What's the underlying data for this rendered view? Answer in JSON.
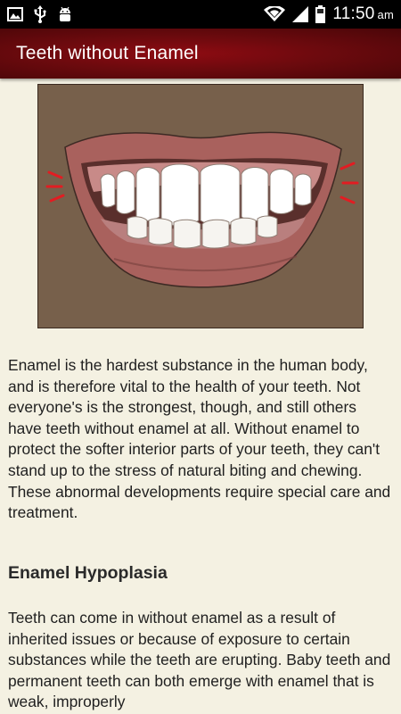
{
  "status_bar": {
    "left_icons": [
      "image-icon",
      "usb-icon",
      "android-icon"
    ],
    "right_icons": [
      "wifi-icon",
      "signal-icon",
      "battery-icon"
    ],
    "time": "11:50",
    "ampm": "am"
  },
  "app_bar": {
    "title": "Teeth without Enamel"
  },
  "article": {
    "illustration_icon": "teeth-smile-illustration",
    "paragraph1": "Enamel is the hardest substance in the human body, and is therefore vital to the health of your teeth. Not everyone's is the strongest, though, and still others have teeth without enamel at all. Without enamel to protect the softer interior parts of your teeth, they can't stand up to the stress of natural biting and chewing. These abnormal developments require special care and treatment.",
    "heading": "Enamel Hypoplasia",
    "paragraph2": "Teeth can come in without enamel as a result of inherited issues or because of exposure to certain substances while the teeth are erupting. Baby teeth and permanent teeth can both emerge with enamel that is weak, improperly"
  },
  "colors": {
    "app_bar": "#6d0a0e",
    "background": "#f4f1e2",
    "illustration_bg": "#77604b",
    "lips": "#a9615d",
    "gums": "#c88a88",
    "accent_marks": "#e21c22"
  }
}
